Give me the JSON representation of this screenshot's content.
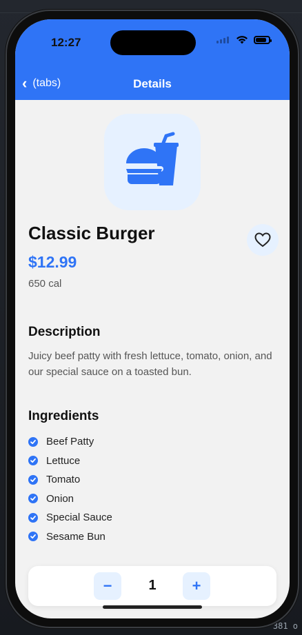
{
  "status_bar": {
    "time": "12:27"
  },
  "nav": {
    "back_label": "(tabs)",
    "title": "Details"
  },
  "product": {
    "name": "Classic Burger",
    "price": "$12.99",
    "calories": "650 cal",
    "icon": "burger-and-drink-icon"
  },
  "description": {
    "title": "Description",
    "text": "Juicy beef patty with fresh lettuce, tomato, onion, and our special sauce on a toasted bun."
  },
  "ingredients": {
    "title": "Ingredients",
    "items": [
      "Beef Patty",
      "Lettuce",
      "Tomato",
      "Onion",
      "Special Sauce",
      "Sesame Bun"
    ]
  },
  "quantity": {
    "value": "1",
    "minus_label": "−",
    "plus_label": "+"
  },
  "colors": {
    "primary": "#2f74f6",
    "tint_bg": "#e6f1ff",
    "screen_bg": "#f2f2f2"
  },
  "background_text": {
    "bottom_right": "381 o"
  }
}
